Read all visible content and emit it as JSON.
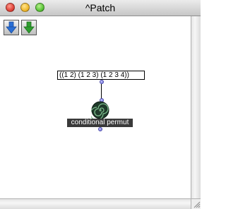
{
  "window": {
    "title": "^Patch"
  },
  "toolbar": {
    "buttons": [
      {
        "icon": "blue-down-arrow-icon"
      },
      {
        "icon": "green-down-arrow-icon"
      }
    ]
  },
  "patch": {
    "input_box": {
      "value": "((1 2) (1 2 3) (1 2 3 4))"
    },
    "function_box": {
      "label": "conditional permut",
      "icon": "spiral-icon"
    }
  },
  "colors": {
    "label_background": "#3a3a3a",
    "outlet": "#6a6ad9",
    "blue_arrow": "#2a6fd6",
    "green_arrow": "#2f9e2f"
  }
}
